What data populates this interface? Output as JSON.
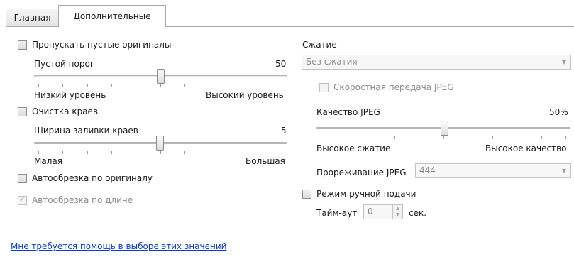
{
  "tabs": [
    {
      "label": "Главная",
      "active": false
    },
    {
      "label": "Дополнительные",
      "active": true
    }
  ],
  "left": {
    "skip_blank": {
      "label": "Пропускать пустые оригиналы",
      "checked": false
    },
    "blank_threshold": {
      "label": "Пустой порог",
      "value": "50",
      "level": 50,
      "low_label": "Низкий уровень",
      "high_label": "Высокий уровень"
    },
    "edge_clean": {
      "label": "Очистка краев",
      "checked": false
    },
    "edge_fill_width": {
      "label": "Ширина заливки краев",
      "value": "5",
      "level": 5,
      "max": 50,
      "low_label": "Малая",
      "high_label": "Большая"
    },
    "autocrop_original": {
      "label": "Автообрезка по оригиналу",
      "checked": false
    },
    "autocrop_length": {
      "label": "Автообрезка по длине",
      "checked": true,
      "enabled": false
    }
  },
  "right": {
    "compression_label": "Сжатие",
    "compression_value": "Без сжатия",
    "fast_jpeg": {
      "label": "Скоростная передача JPEG",
      "checked": false,
      "enabled": false
    },
    "jpeg_quality": {
      "label": "Качество JPEG",
      "value": "50%",
      "level": 50,
      "low_label": "Высокое сжатие",
      "high_label": "Высокое качество"
    },
    "jpeg_subsampling": {
      "label": "Прореживание JPEG",
      "value": "444"
    },
    "manual_feed": {
      "label": "Режим ручной подачи",
      "checked": false
    },
    "timeout": {
      "label": "Тайм-аут",
      "value": "0",
      "unit": "сек."
    }
  },
  "help_link": "Мне требуется помощь в выборе этих значений",
  "colors": {
    "link": "#0b3cd6",
    "disabled_text": "#8a8a8a"
  }
}
